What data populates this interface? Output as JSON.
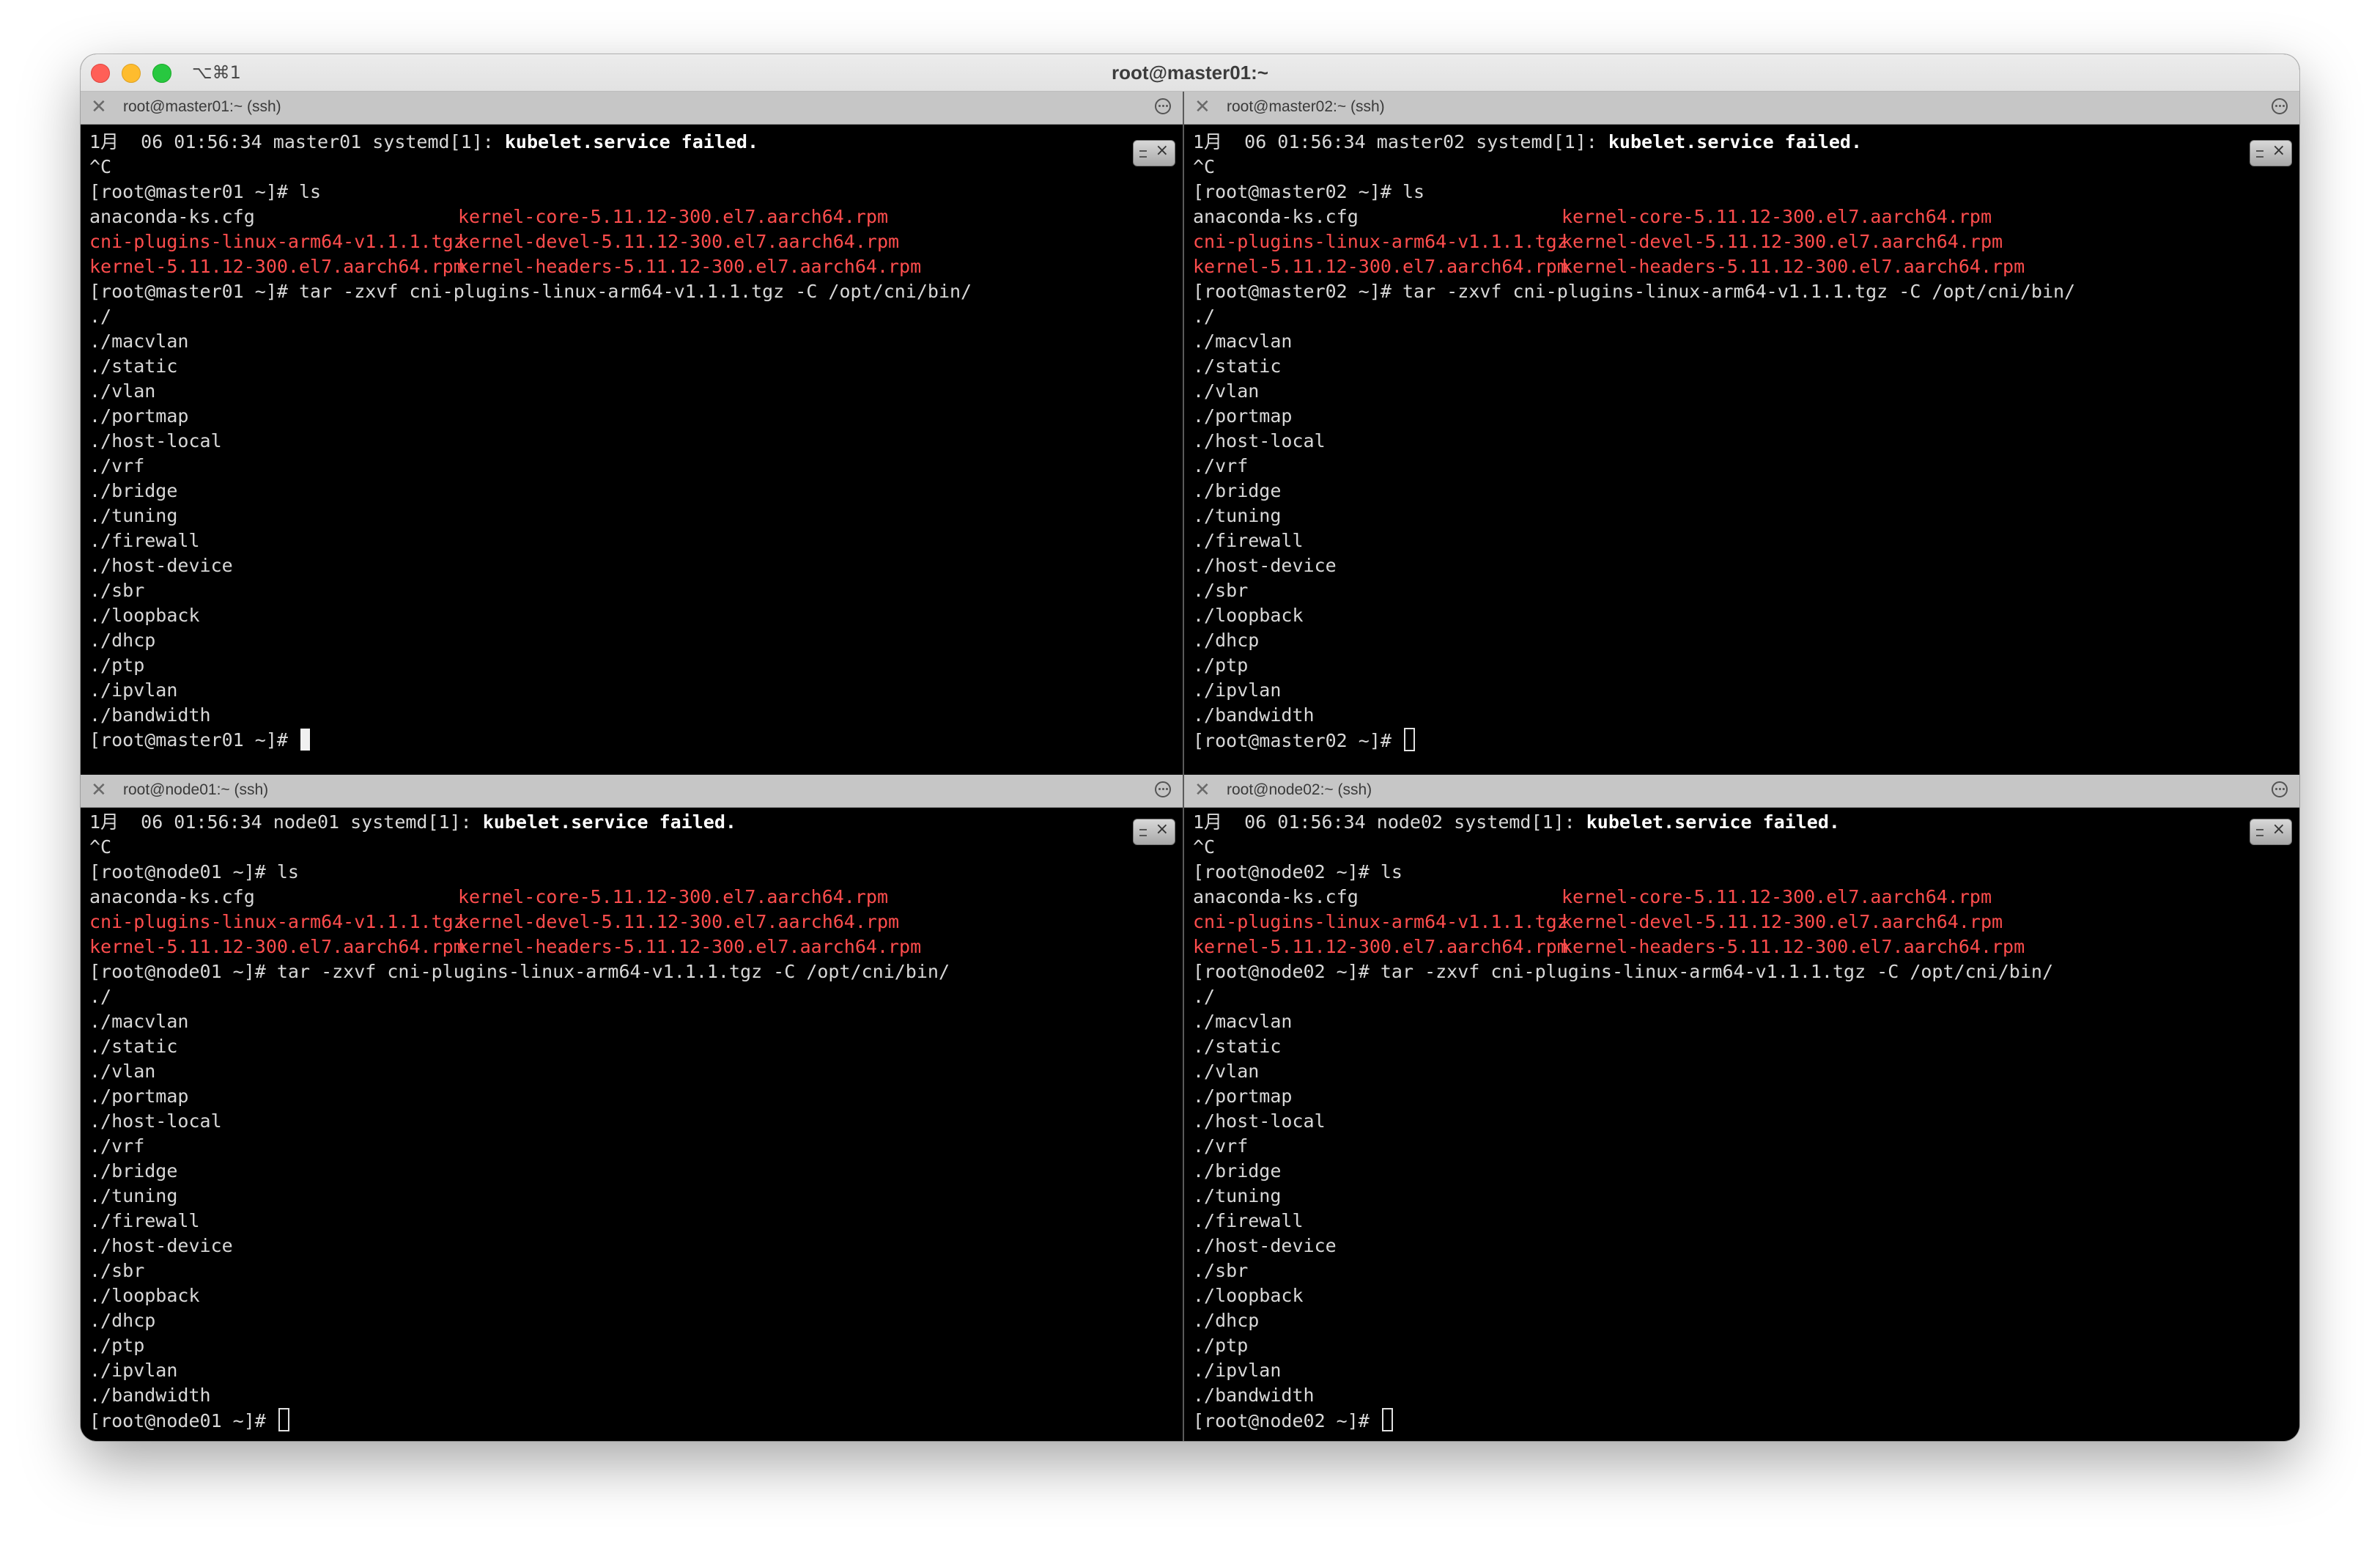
{
  "window": {
    "title": "root@master01:~",
    "shortcut": "⌥⌘1"
  },
  "panes": [
    {
      "tab_title": "root@master01:~ (ssh)",
      "syslog_prefix": "1月  06 01:56:34 master01 systemd[1]: ",
      "syslog_bold": "kubelet.service failed.",
      "ctrl_c": "^C",
      "ls_prompt": "[root@master01 ~]# ls",
      "ls_rows": [
        {
          "a": "anaconda-ks.cfg",
          "b": "kernel-core-5.11.12-300.el7.aarch64.rpm"
        },
        {
          "a": "cni-plugins-linux-arm64-v1.1.1.tgz",
          "b": "kernel-devel-5.11.12-300.el7.aarch64.rpm"
        },
        {
          "a": "kernel-5.11.12-300.el7.aarch64.rpm",
          "b": "kernel-headers-5.11.12-300.el7.aarch64.rpm"
        }
      ],
      "tar_cmd": "[root@master01 ~]# tar -zxvf cni-plugins-linux-arm64-v1.1.1.tgz -C /opt/cni/bin/",
      "files": [
        "./",
        "./macvlan",
        "./static",
        "./vlan",
        "./portmap",
        "./host-local",
        "./vrf",
        "./bridge",
        "./tuning",
        "./firewall",
        "./host-device",
        "./sbr",
        "./loopback",
        "./dhcp",
        "./ptp",
        "./ipvlan",
        "./bandwidth"
      ],
      "final_prompt": "[root@master01 ~]# "
    },
    {
      "tab_title": "root@master02:~ (ssh)",
      "syslog_prefix": "1月  06 01:56:34 master02 systemd[1]: ",
      "syslog_bold": "kubelet.service failed.",
      "ctrl_c": "^C",
      "ls_prompt": "[root@master02 ~]# ls",
      "ls_rows": [
        {
          "a": "anaconda-ks.cfg",
          "b": "kernel-core-5.11.12-300.el7.aarch64.rpm"
        },
        {
          "a": "cni-plugins-linux-arm64-v1.1.1.tgz",
          "b": "kernel-devel-5.11.12-300.el7.aarch64.rpm"
        },
        {
          "a": "kernel-5.11.12-300.el7.aarch64.rpm",
          "b": "kernel-headers-5.11.12-300.el7.aarch64.rpm"
        }
      ],
      "tar_cmd": "[root@master02 ~]# tar -zxvf cni-plugins-linux-arm64-v1.1.1.tgz -C /opt/cni/bin/",
      "files": [
        "./",
        "./macvlan",
        "./static",
        "./vlan",
        "./portmap",
        "./host-local",
        "./vrf",
        "./bridge",
        "./tuning",
        "./firewall",
        "./host-device",
        "./sbr",
        "./loopback",
        "./dhcp",
        "./ptp",
        "./ipvlan",
        "./bandwidth"
      ],
      "final_prompt": "[root@master02 ~]# "
    },
    {
      "tab_title": "root@node01:~ (ssh)",
      "syslog_prefix": "1月  06 01:56:34 node01 systemd[1]: ",
      "syslog_bold": "kubelet.service failed.",
      "ctrl_c": "^C",
      "ls_prompt": "[root@node01 ~]# ls",
      "ls_rows": [
        {
          "a": "anaconda-ks.cfg",
          "b": "kernel-core-5.11.12-300.el7.aarch64.rpm"
        },
        {
          "a": "cni-plugins-linux-arm64-v1.1.1.tgz",
          "b": "kernel-devel-5.11.12-300.el7.aarch64.rpm"
        },
        {
          "a": "kernel-5.11.12-300.el7.aarch64.rpm",
          "b": "kernel-headers-5.11.12-300.el7.aarch64.rpm"
        }
      ],
      "tar_cmd": "[root@node01 ~]# tar -zxvf cni-plugins-linux-arm64-v1.1.1.tgz -C /opt/cni/bin/",
      "files": [
        "./",
        "./macvlan",
        "./static",
        "./vlan",
        "./portmap",
        "./host-local",
        "./vrf",
        "./bridge",
        "./tuning",
        "./firewall",
        "./host-device",
        "./sbr",
        "./loopback",
        "./dhcp",
        "./ptp",
        "./ipvlan",
        "./bandwidth"
      ],
      "final_prompt": "[root@node01 ~]# "
    },
    {
      "tab_title": "root@node02:~ (ssh)",
      "syslog_prefix": "1月  06 01:56:34 node02 systemd[1]: ",
      "syslog_bold": "kubelet.service failed.",
      "ctrl_c": "^C",
      "ls_prompt": "[root@node02 ~]# ls",
      "ls_rows": [
        {
          "a": "anaconda-ks.cfg",
          "b": "kernel-core-5.11.12-300.el7.aarch64.rpm"
        },
        {
          "a": "cni-plugins-linux-arm64-v1.1.1.tgz",
          "b": "kernel-devel-5.11.12-300.el7.aarch64.rpm"
        },
        {
          "a": "kernel-5.11.12-300.el7.aarch64.rpm",
          "b": "kernel-headers-5.11.12-300.el7.aarch64.rpm"
        }
      ],
      "tar_cmd": "[root@node02 ~]# tar -zxvf cni-plugins-linux-arm64-v1.1.1.tgz -C /opt/cni/bin/",
      "files": [
        "./",
        "./macvlan",
        "./static",
        "./vlan",
        "./portmap",
        "./host-local",
        "./vrf",
        "./bridge",
        "./tuning",
        "./firewall",
        "./host-device",
        "./sbr",
        "./loopback",
        "./dhcp",
        "./ptp",
        "./ipvlan",
        "./bandwidth"
      ],
      "final_prompt": "[root@node02 ~]# "
    }
  ],
  "colors": {
    "terminal_bg": "#000000",
    "terminal_fg": "#d8d8d8",
    "archive_red": "#ff4d4d",
    "tabbar_bg": "#c6c6c6",
    "titlebar_bg": "#e6e6e6"
  },
  "icons": {
    "tab_close": "close-icon",
    "tab_menu": "ellipsis-circle-icon",
    "scroll_badge": "scroll-lock-icon"
  }
}
